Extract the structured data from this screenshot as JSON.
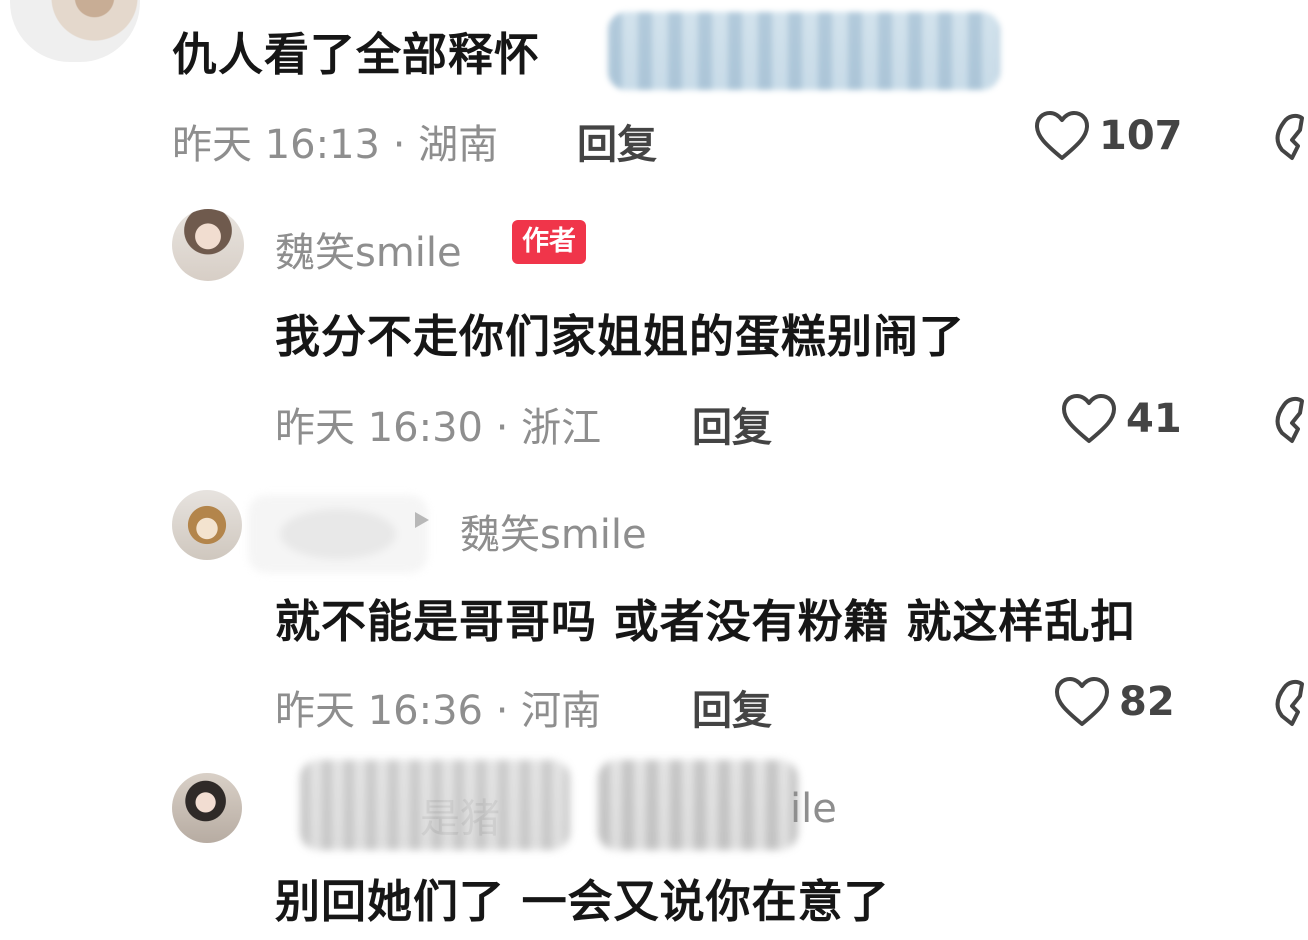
{
  "comments": [
    {
      "text": "仇人看了全部释怀",
      "meta": "昨天 16:13 · 湖南",
      "reply_label": "回复",
      "likes": "107"
    },
    {
      "username": "魏笑smile",
      "badge": "作者",
      "text": "我分不走你们家姐姐的蛋糕别闹了",
      "meta": "昨天 16:30 · 浙江",
      "reply_label": "回复",
      "likes": "41"
    },
    {
      "reply_to": "魏笑smile",
      "text": "就不能是哥哥吗 或者没有粉籍 就这样乱扣",
      "meta": "昨天 16:36 · 河南",
      "reply_label": "回复",
      "likes": "82"
    },
    {
      "username_partial": "是猪",
      "username_tail": "ile",
      "text": "别回她们了 一会又说你在意了"
    }
  ],
  "icons": {
    "like": "heart-outline-icon",
    "dislike": "broken-heart-icon",
    "reply_arrow": "triangle-right-icon"
  },
  "colors": {
    "author_badge": "#f0354a",
    "meta_text": "#8e8e8e",
    "primary_text": "#161616"
  }
}
